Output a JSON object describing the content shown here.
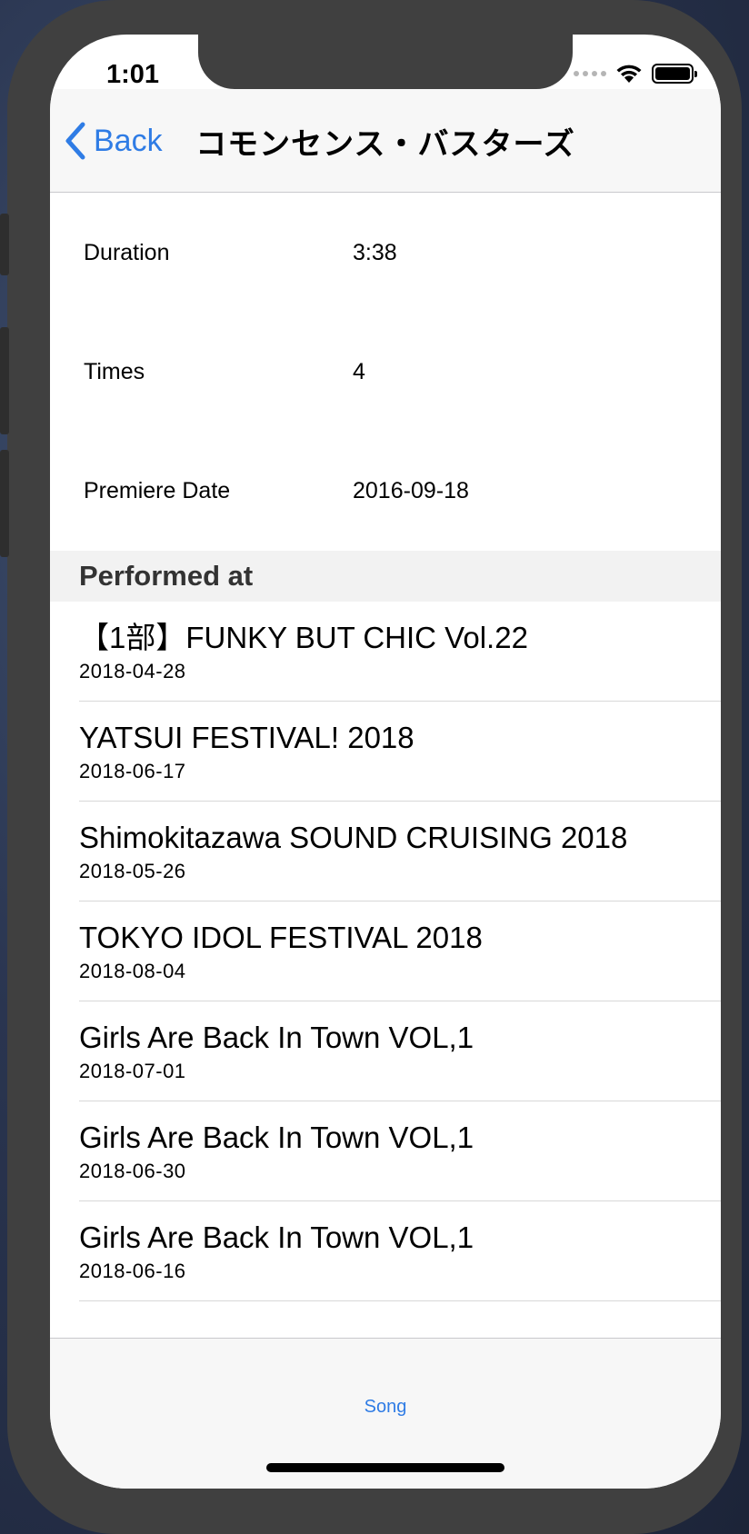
{
  "status": {
    "time": "1:01"
  },
  "nav": {
    "back_label": "Back",
    "title": "コモンセンス・バスターズ"
  },
  "details": [
    {
      "label": "Duration",
      "value": "3:38"
    },
    {
      "label": "Times",
      "value": "4"
    },
    {
      "label": "Premiere Date",
      "value": "2016-09-18"
    }
  ],
  "performed": {
    "header": "Performed at",
    "items": [
      {
        "name": "【1部】FUNKY BUT CHIC Vol.22",
        "date": "2018-04-28"
      },
      {
        "name": "YATSUI FESTIVAL! 2018",
        "date": "2018-06-17"
      },
      {
        "name": "Shimokitazawa SOUND CRUISING 2018",
        "date": "2018-05-26"
      },
      {
        "name": "TOKYO IDOL FESTIVAL 2018",
        "date": "2018-08-04"
      },
      {
        "name": "Girls Are Back In Town VOL,1",
        "date": "2018-07-01"
      },
      {
        "name": "Girls Are Back In Town VOL,1",
        "date": "2018-06-30"
      },
      {
        "name": "Girls Are Back In Town VOL,1",
        "date": "2018-06-16"
      }
    ]
  },
  "tabbar": {
    "song_label": "Song"
  },
  "colors": {
    "accent": "#2f7ce5",
    "frame": "#404040"
  },
  "icons": {
    "back": "chevron-left-icon",
    "wifi": "wifi-icon",
    "battery": "battery-icon",
    "signal": "cellular-signal-icon"
  }
}
